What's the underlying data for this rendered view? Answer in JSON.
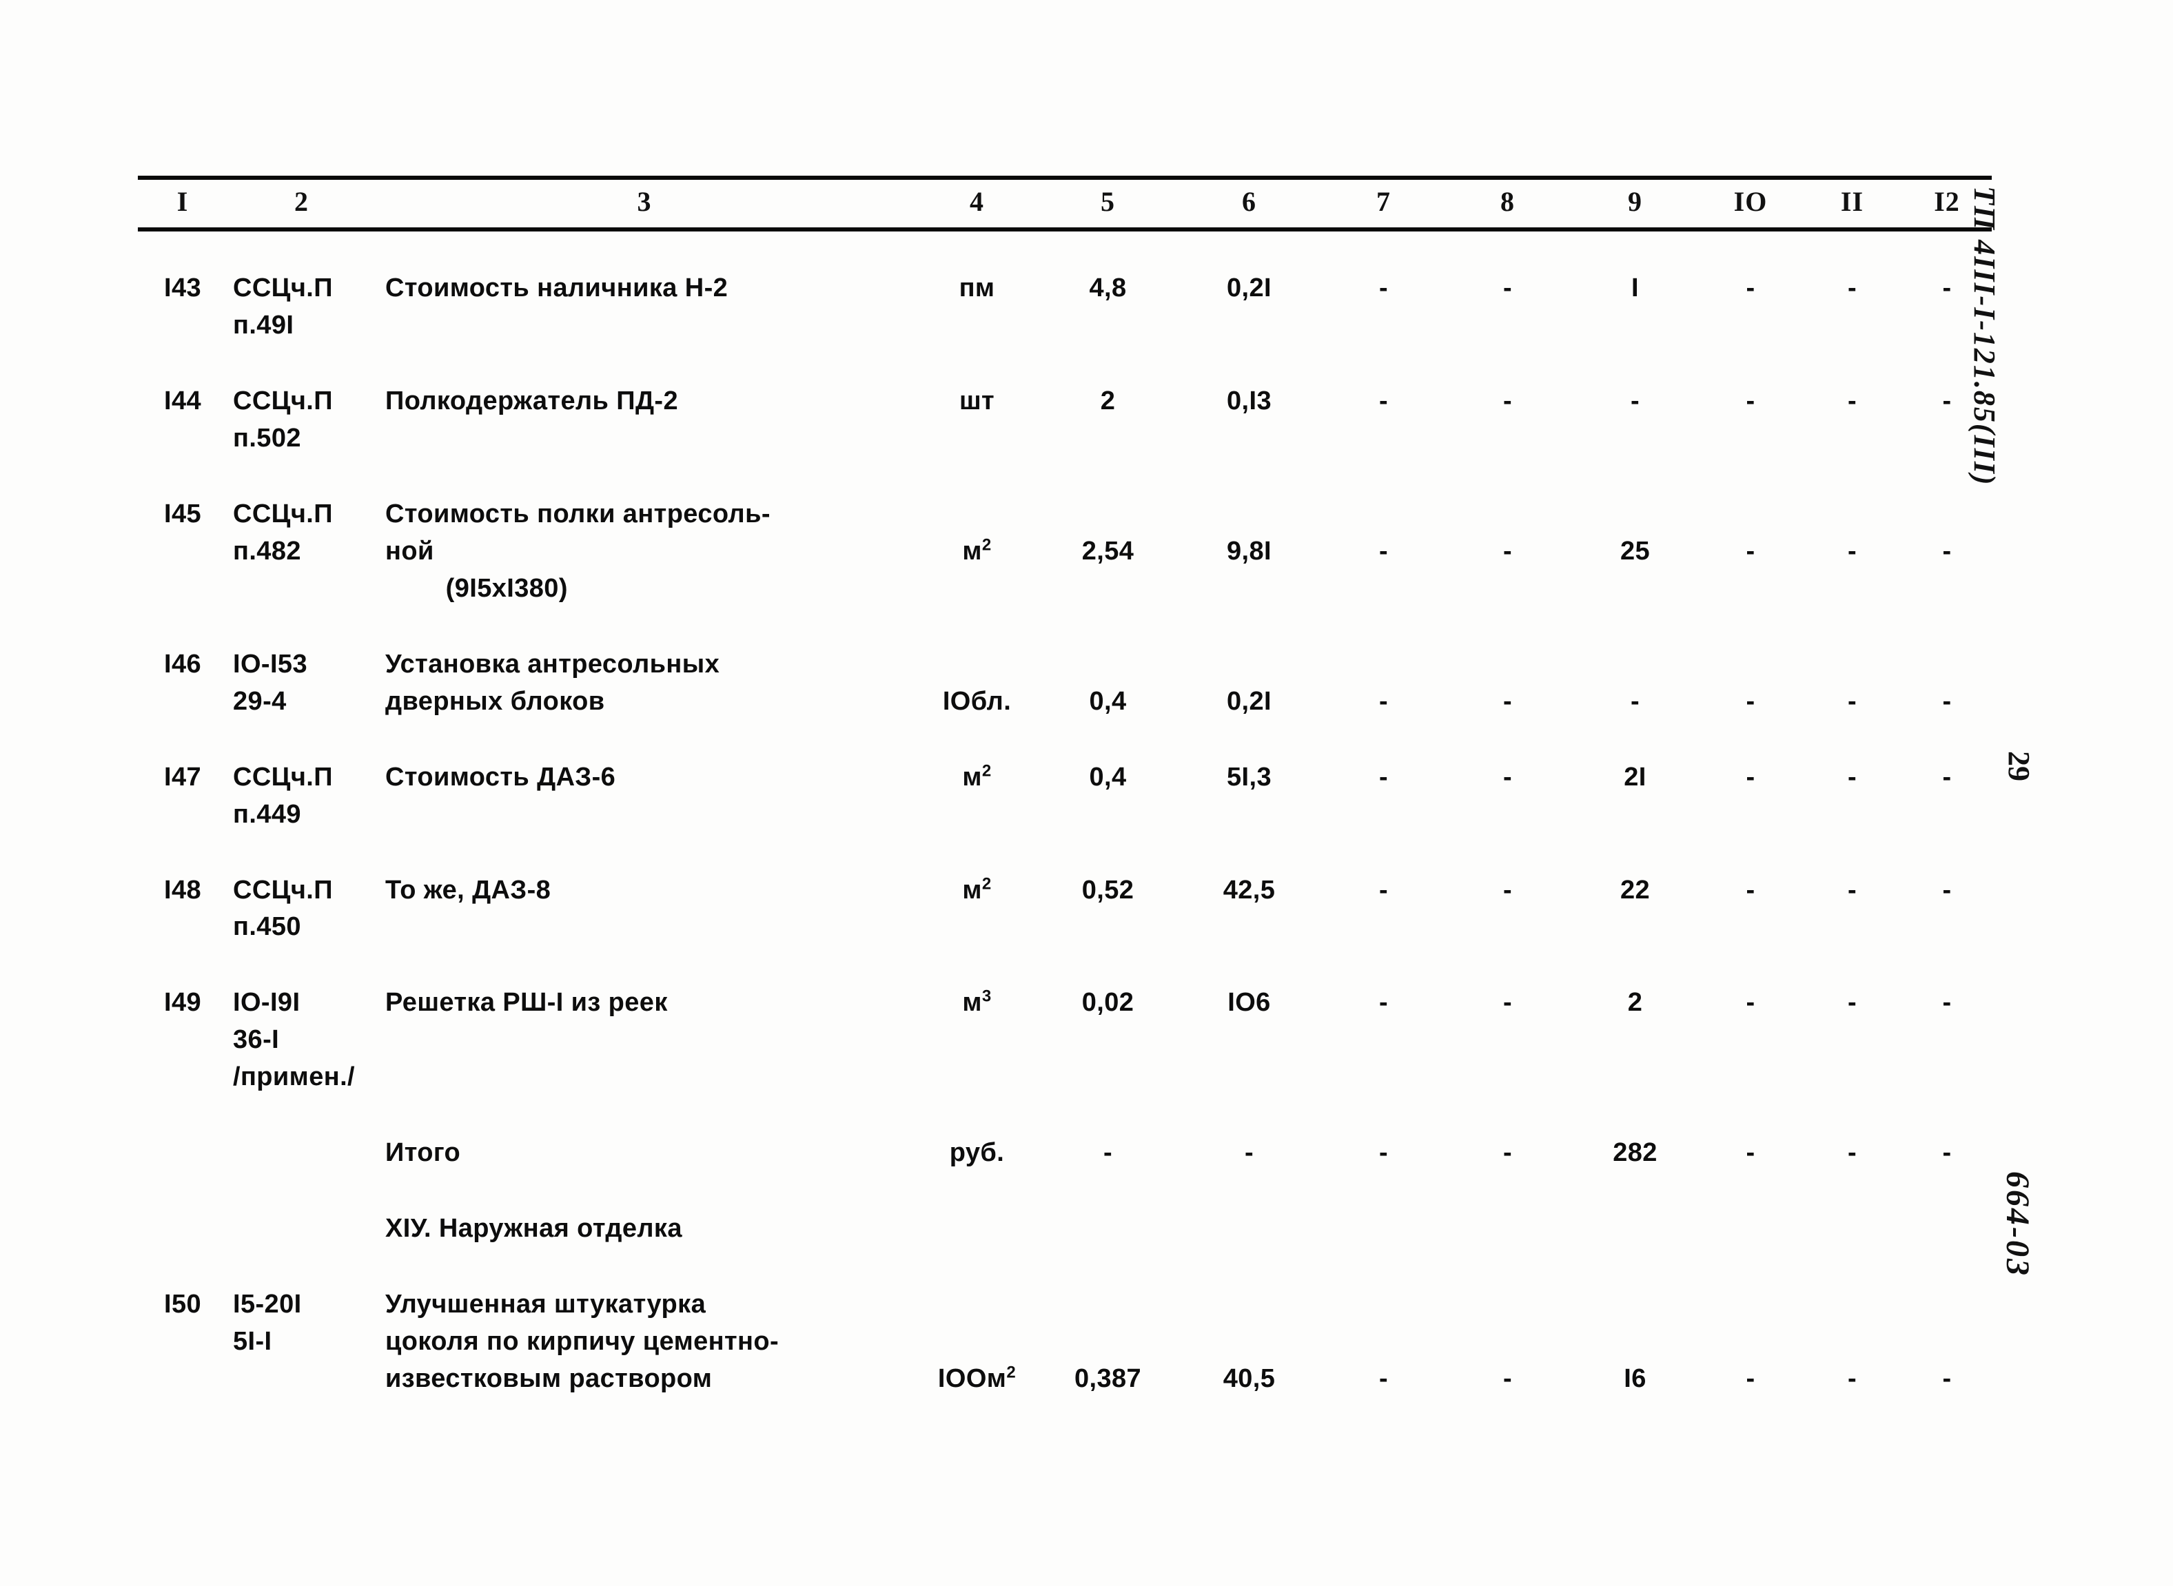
{
  "document": {
    "margin_notes": {
      "project_code": "ТП 4III-I-121.85(III)",
      "page_number": "29",
      "sheet_code": "664-03"
    }
  },
  "table": {
    "column_headers": [
      "I",
      "2",
      "3",
      "4",
      "5",
      "6",
      "7",
      "8",
      "9",
      "IO",
      "II",
      "I2"
    ],
    "rows": [
      {
        "kind": "item",
        "index": "I43",
        "code_lines": [
          "ССЦч.П",
          "п.49I"
        ],
        "desc_lines": [
          "Стоимость наличника Н-2"
        ],
        "unit": "пм",
        "unit_sup": "",
        "col5": "4,8",
        "col6": "0,2I",
        "col7": "-",
        "col8": "-",
        "col9": "I",
        "col10": "-",
        "col11": "-",
        "col12": "-",
        "num_align": "l1"
      },
      {
        "kind": "item",
        "index": "I44",
        "code_lines": [
          "ССЦч.П",
          "п.502"
        ],
        "desc_lines": [
          "Полкодержатель ПД-2"
        ],
        "unit": "шт",
        "unit_sup": "",
        "col5": "2",
        "col6": "0,I3",
        "col7": "-",
        "col8": "-",
        "col9": "-",
        "col10": "-",
        "col11": "-",
        "col12": "-",
        "num_align": "l1"
      },
      {
        "kind": "item",
        "index": "I45",
        "code_lines": [
          "ССЦч.П",
          "п.482"
        ],
        "desc_lines": [
          "Стоимость полки антресоль-",
          "ной",
          "        (9I5хI380)"
        ],
        "unit": "м",
        "unit_sup": "2",
        "col5": "2,54",
        "col6": "9,8I",
        "col7": "-",
        "col8": "-",
        "col9": "25",
        "col10": "-",
        "col11": "-",
        "col12": "-",
        "num_align": "l2"
      },
      {
        "kind": "item",
        "index": "I46",
        "code_lines": [
          "IO-I53",
          "29-4"
        ],
        "desc_lines": [
          "Установка антресольных",
          "дверных блоков"
        ],
        "unit": "IОбл.",
        "unit_sup": "",
        "col5": "0,4",
        "col6": "0,2I",
        "col7": "-",
        "col8": "-",
        "col9": "-",
        "col10": "-",
        "col11": "-",
        "col12": "-",
        "num_align": "l2"
      },
      {
        "kind": "item",
        "index": "I47",
        "code_lines": [
          "ССЦч.П",
          "п.449"
        ],
        "desc_lines": [
          "Стоимость ДАЗ-6"
        ],
        "unit": "м",
        "unit_sup": "2",
        "col5": "0,4",
        "col6": "5I,3",
        "col7": "-",
        "col8": "-",
        "col9": "2I",
        "col10": "-",
        "col11": "-",
        "col12": "-",
        "num_align": "l1"
      },
      {
        "kind": "item",
        "index": "I48",
        "code_lines": [
          "ССЦч.П",
          "п.450"
        ],
        "desc_lines": [
          "То же, ДАЗ-8"
        ],
        "unit": "м",
        "unit_sup": "2",
        "col5": "0,52",
        "col6": "42,5",
        "col7": "-",
        "col8": "-",
        "col9": "22",
        "col10": "-",
        "col11": "-",
        "col12": "-",
        "num_align": "l1"
      },
      {
        "kind": "item",
        "index": "I49",
        "code_lines": [
          "IO-I9I",
          "36-I",
          "/примен./"
        ],
        "desc_lines": [
          "Решетка РШ-I из реек"
        ],
        "unit": "м",
        "unit_sup": "3",
        "col5": "0,02",
        "col6": "IО6",
        "col7": "-",
        "col8": "-",
        "col9": "2",
        "col10": "-",
        "col11": "-",
        "col12": "-",
        "num_align": "l1"
      },
      {
        "kind": "total",
        "index": "",
        "code_lines": [],
        "desc_lines": [
          "Итого"
        ],
        "unit": "руб.",
        "unit_sup": "",
        "col5": "-",
        "col6": "-",
        "col7": "-",
        "col8": "-",
        "col9": "282",
        "col10": "-",
        "col11": "-",
        "col12": "-",
        "num_align": "l1"
      },
      {
        "kind": "section",
        "index": "",
        "code_lines": [],
        "desc_lines": [
          "XIУ. Наружная отделка"
        ],
        "unit": "",
        "unit_sup": "",
        "col5": "",
        "col6": "",
        "col7": "",
        "col8": "",
        "col9": "",
        "col10": "",
        "col11": "",
        "col12": "",
        "num_align": "l1"
      },
      {
        "kind": "item",
        "index": "I50",
        "code_lines": [
          "I5-20I",
          "5I-I"
        ],
        "desc_lines": [
          "Улучшенная штукатурка",
          "цоколя по кирпичу цементно-",
          "известковым раствором"
        ],
        "unit": "IООм",
        "unit_sup": "2",
        "col5": "0,387",
        "col6": "40,5",
        "col7": "-",
        "col8": "-",
        "col9": "I6",
        "col10": "-",
        "col11": "-",
        "col12": "-",
        "num_align": "l3"
      }
    ]
  }
}
